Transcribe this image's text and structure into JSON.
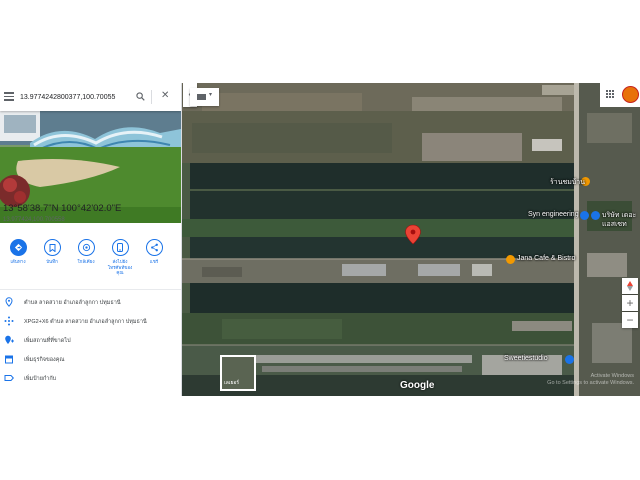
{
  "search": {
    "value": "13.9774242800377,100.70055",
    "menu_icon": "hamburger-menu-icon",
    "search_icon": "magnifier-icon",
    "clear_icon": "close-icon",
    "clear_glyph": "✕"
  },
  "collapse": {
    "glyph": "‹"
  },
  "place": {
    "coords_dms": "13°58'38.7\"N 100°42'02.0\"E",
    "coords_decimal": "13.977424,100.700558"
  },
  "actions": [
    {
      "label": "เส้นทาง",
      "icon": "directions-icon",
      "filled": true
    },
    {
      "label": "บันทึก",
      "icon": "bookmark-icon",
      "filled": false
    },
    {
      "label": "ใกล้เคียง",
      "icon": "nearby-icon",
      "filled": false
    },
    {
      "label": "ส่งไปยังโทรศัพท์ของคุณ",
      "icon": "phone-icon",
      "filled": false
    },
    {
      "label": "แชร์",
      "icon": "share-icon",
      "filled": false
    }
  ],
  "info_rows": [
    {
      "text": "ตำบล ลาดสวาย อำเภอลำลูกกา ปทุมธานี",
      "icon": "location-pin-icon"
    },
    {
      "text": "XPG2+X6 ตำบล ลาดสวาย อำเภอลำลูกกา ปทุมธานี",
      "icon": "plus-code-icon"
    },
    {
      "text": "เพิ่มสถานที่ที่ขาดไป",
      "icon": "add-place-icon"
    },
    {
      "text": "เพิ่มธุรกิจของคุณ",
      "icon": "business-icon"
    },
    {
      "text": "เพิ่มป้ายกำกับ",
      "icon": "label-icon"
    }
  ],
  "map": {
    "labels": {
      "poi_1": "ร้านชมบ้าน",
      "poi_2": "Syn engineering",
      "poi_3": "บริษัท เดอะ",
      "poi_4": "แอสเซท",
      "poi_5": "Jana Cafe & Bistro",
      "poi_6": "Sweetiestudio"
    },
    "google_logo": "Google",
    "watermark_line1": "Activate Windows",
    "watermark_line2": "Go to Settings to activate Windows.",
    "satellite_toggle_label": "เลเยอร์",
    "zoom_in": "+",
    "zoom_out": "−",
    "colors": {
      "pin": "#ea4335",
      "poi_orange": "#f29900",
      "poi_blue": "#1a73e8",
      "link_blue": "#1a73e8"
    }
  }
}
